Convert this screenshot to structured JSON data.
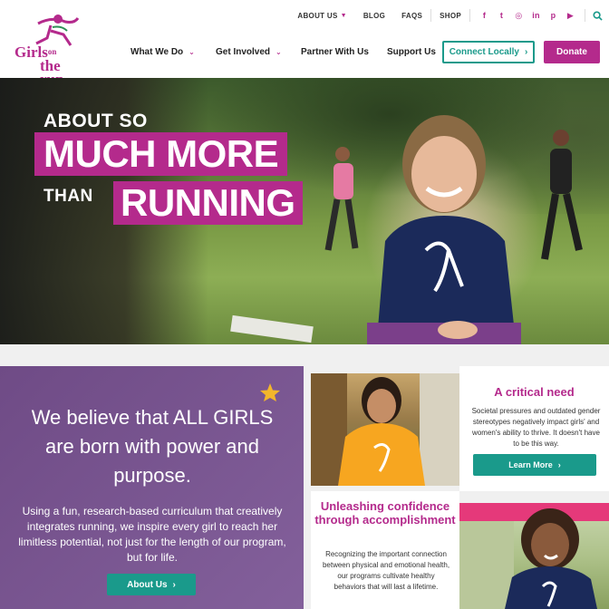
{
  "brand": {
    "logo_line1": "Girls",
    "logo_on": "on",
    "logo_line2": "the run",
    "accent": "#b42a8c",
    "teal": "#1a9a8b",
    "purple": "#7a5592"
  },
  "topnav": {
    "about": "ABOUT US",
    "blog": "BLOG",
    "faqs": "FAQS",
    "shop": "SHOP",
    "social_icons": [
      "facebook-icon",
      "twitter-icon",
      "instagram-icon",
      "linkedin-icon",
      "pinterest-icon",
      "youtube-icon"
    ],
    "social_glyphs": [
      "f",
      "t",
      "◎",
      "in",
      "p",
      "▶"
    ]
  },
  "mainnav": {
    "what_we_do": "What We Do",
    "get_involved": "Get Involved",
    "partner": "Partner With Us",
    "support": "Support Us",
    "connect": "Connect Locally",
    "donate": "Donate"
  },
  "hero": {
    "line1": "ABOUT SO",
    "line2": "MUCH MORE",
    "line3": "THAN",
    "line4": "RUNNING"
  },
  "believe": {
    "heading": "We believe that ALL GIRLS are born with power and purpose.",
    "body": "Using a fun, research-based curriculum that creatively integrates running, we inspire every girl to reach her limitless potential, not just for the length of our program, but for life.",
    "button": "About Us"
  },
  "critical": {
    "title": "A critical need",
    "body": "Societal pressures and outdated gender stereotypes negatively impact girls' and women's ability to thrive. It doesn't have to be this way.",
    "button": "Learn More"
  },
  "confidence": {
    "title": "Unleashing confidence through accomplishment",
    "body": "Recognizing the important connection between physical and emotional health, our programs cultivate healthy behaviors that will last a lifetime."
  }
}
